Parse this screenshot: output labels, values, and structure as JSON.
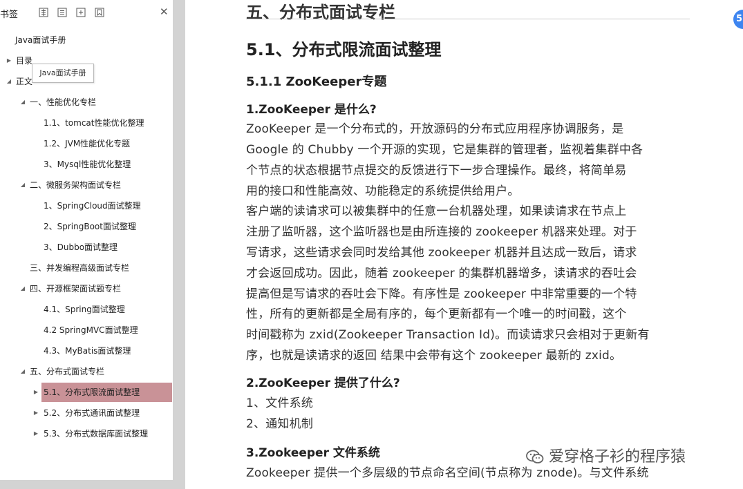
{
  "sidebar": {
    "title": "书签",
    "tooltip": "Java面试手册",
    "items": [
      {
        "label": "Java面试手册"
      },
      {
        "label": "目录"
      },
      {
        "label": "正文"
      },
      {
        "label": "一、性能优化专栏"
      },
      {
        "label": "1.1、tomcat性能优化整理"
      },
      {
        "label": "1.2、JVM性能优化专题"
      },
      {
        "label": "3、Mysql性能优化整理"
      },
      {
        "label": "二、微服务架构面试专栏"
      },
      {
        "label": "1、SpringCloud面试整理"
      },
      {
        "label": "2、SpringBoot面试整理"
      },
      {
        "label": "3、Dubbo面试整理"
      },
      {
        "label": "三、并发编程高级面试专栏"
      },
      {
        "label": "四、开源框架面试题专栏"
      },
      {
        "label": "4.1、Spring面试整理"
      },
      {
        "label": "4.2 SpringMVC面试整理"
      },
      {
        "label": "4.3、MyBatis面试整理"
      },
      {
        "label": "五、分布式面试专栏"
      },
      {
        "label": "5.1、分布式限流面试整理"
      },
      {
        "label": "5.2、分布式通讯面试整理"
      },
      {
        "label": "5.3、分布式数据库面试整理"
      }
    ]
  },
  "document": {
    "chapter_title": "五、分布式面试专栏",
    "section_title": "5.1、分布式限流面试整理",
    "subsection_title": "5.1.1 ZooKeeper专题",
    "q1_title": "1.ZooKeeper 是什么?",
    "q1_lines": [
      "ZooKeeper 是一个分布式的，开放源码的分布式应用程序协调服务，是",
      "Google 的 Chubby 一个开源的实现，它是集群的管理者，监视着集群中各",
      "个节点的状态根据节点提交的反馈进行下一步合理操作。最终，将简单易",
      "用的接口和性能高效、功能稳定的系统提供给用户。",
      "客户端的读请求可以被集群中的任意一台机器处理，如果读请求在节点上",
      "注册了监听器，这个监听器也是由所连接的 zookeeper 机器来处理。对于",
      "写请求，这些请求会同时发给其他 zookeeper 机器并且达成一致后，请求",
      "才会返回成功。因此，随着 zookeeper 的集群机器增多，读请求的吞吐会",
      "提高但是写请求的吞吐会下降。有序性是 zookeeper 中非常重要的一个特",
      "性，所有的更新都是全局有序的，每个更新都有一个唯一的时间戳，这个",
      "时间戳称为 zxid(Zookeeper Transaction Id)。而读请求只会相对于更新有",
      "序，也就是读请求的返回 结果中会带有这个 zookeeper 最新的 zxid。"
    ],
    "q2_title": "2.ZooKeeper 提供了什么?",
    "q2_lines": [
      "1、文件系统",
      "2、通知机制"
    ],
    "q3_title": "3.Zookeeper 文件系统",
    "q3_lines": [
      "Zookeeper 提供一个多层级的节点命名空间(节点称为 znode)。与文件系统"
    ]
  },
  "watermark": {
    "text": "爱穿格子衫的程序猿"
  },
  "badge": {
    "text": "5"
  },
  "colors": {
    "selected": "#c99297",
    "accent_blue": "#3d85f0"
  }
}
